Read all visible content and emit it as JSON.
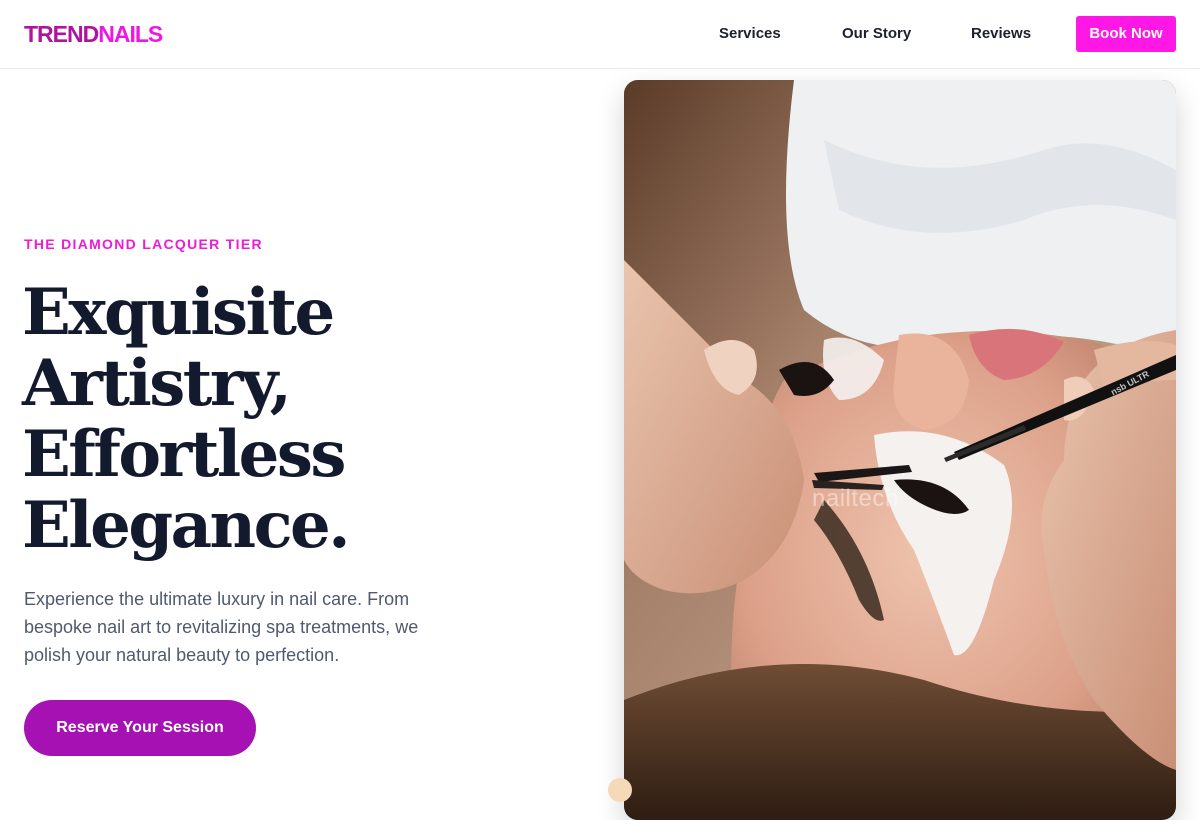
{
  "brand": {
    "logo_part1": "TREND",
    "logo_part2": "NAILS"
  },
  "nav": {
    "links": [
      "Services",
      "Our Story",
      "Reviews"
    ],
    "cta_label": "Book Now"
  },
  "hero": {
    "eyebrow": "THE DIAMOND LACQUER TIER",
    "headline_lines": [
      "Exquisite",
      "Artistry,",
      "Effortless",
      "Elegance."
    ],
    "subtext": "Experience the ultimate luxury in nail care. From bespoke nail art to revitalizing spa treatments, we polish your natural beauty to perfection.",
    "cta_label": "Reserve Your Session",
    "image": {
      "subject": "lash-extension-treatment-photo",
      "watermark_text": "nailtech",
      "tweezer_text": "nsb ULTR"
    }
  },
  "colors": {
    "brand_magenta": "#ff17e6",
    "brand_purple": "#a511b2",
    "logo_dark": "#b0149f",
    "headline": "#141a2e",
    "body_text": "#4f5a6e"
  }
}
